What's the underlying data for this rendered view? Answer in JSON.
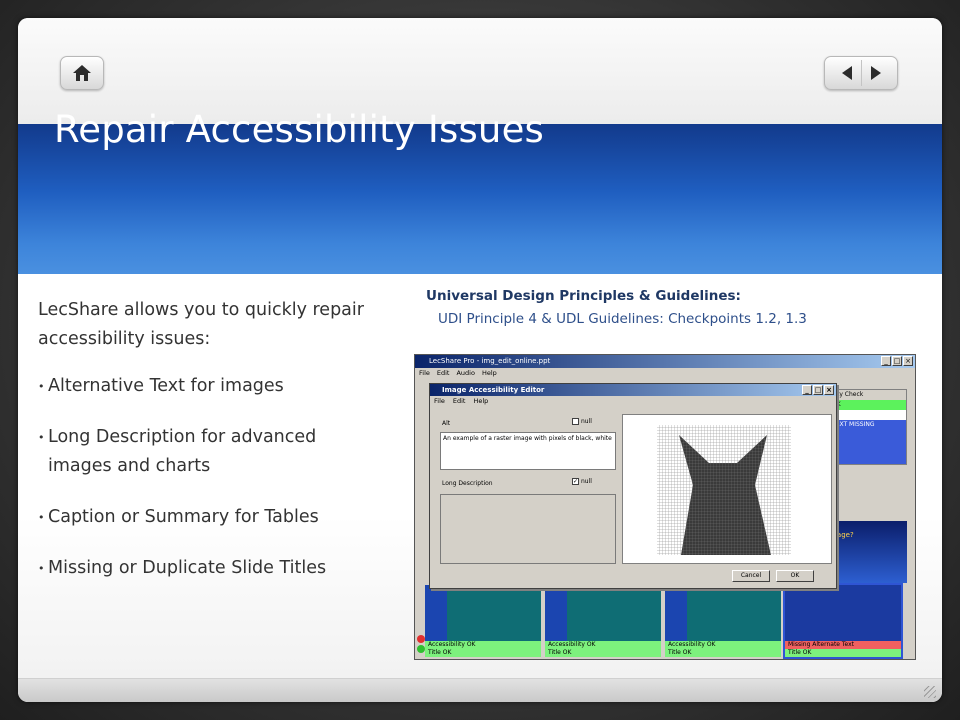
{
  "slide": {
    "title": "Repair Accessibility Issues",
    "intro": "LecShare allows you to quickly repair accessibility issues:",
    "bullets": [
      "Alternative Text for images",
      "Long Description for advanced images and charts",
      "Caption or Summary for Tables",
      "Missing or Duplicate Slide Titles"
    ],
    "udp_title": "Universal Design Principles & Guidelines:",
    "udp_sub": "UDI Principle 4 & UDL Guidelines: Checkpoints 1.2, 1.3"
  },
  "nav": {
    "home_icon": "home-icon",
    "prev_icon": "left-arrow-icon",
    "next_icon": "right-arrow-icon"
  },
  "app": {
    "window_title": "LecShare Pro - img_edit_online.ppt",
    "menu": [
      "File",
      "Edit",
      "Audio",
      "Help"
    ],
    "panel": {
      "header": "ility Check",
      "rows": [
        "OK",
        "",
        "TEXT MISSING"
      ]
    },
    "right_slide_text": "p a digital image?",
    "thumbnails": [
      {
        "status1": "Accessibility OK",
        "status2": "Title OK"
      },
      {
        "status1": "Accessibility OK",
        "status2": "Title OK"
      },
      {
        "status1": "Accessibility OK",
        "status2": "Title OK"
      },
      {
        "status1": "Missing Alternate Text",
        "status2": "Title OK"
      }
    ],
    "dialog": {
      "title": "Image Accessibility Editor",
      "menu": [
        "File",
        "Edit",
        "Help"
      ],
      "alt_label": "Alt",
      "alt_null_label": "null",
      "alt_value": "An example of a raster image with pixels of black, white",
      "ld_label": "Long Description",
      "ld_null_label": "null",
      "cancel": "Cancel",
      "ok": "OK"
    }
  },
  "colors": {
    "title_band": "#1f5ec0",
    "title_text": "#ffffff",
    "udp_title": "#1f3864",
    "body_text": "#333333"
  }
}
